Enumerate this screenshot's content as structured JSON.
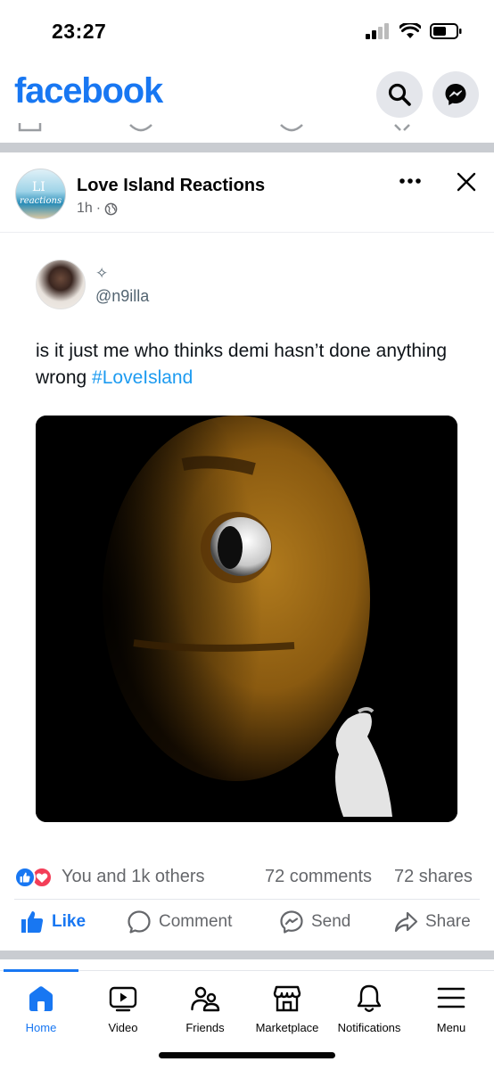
{
  "status_bar": {
    "time": "23:27"
  },
  "header": {
    "logo": "facebook",
    "search_icon": "search-icon",
    "messenger_icon": "messenger-icon"
  },
  "post": {
    "page_name": "Love Island Reactions",
    "time": "1h",
    "separator": "·",
    "audience_icon": "globe-icon",
    "avatar_ll": "LI",
    "avatar_text": "reactions",
    "tweet": {
      "sparkle": "✧",
      "handle": "@n9illa",
      "text": "is it just me who thinks demi hasn’t done anything wrong ",
      "hashtag": "#LoveIsland"
    },
    "reactions_text": "You and 1k others",
    "comments": "72 comments",
    "shares": "72 shares"
  },
  "actions": {
    "like": "Like",
    "comment": "Comment",
    "send": "Send",
    "share": "Share"
  },
  "tabs": [
    {
      "label": "Home",
      "icon": "home-icon"
    },
    {
      "label": "Video",
      "icon": "video-icon"
    },
    {
      "label": "Friends",
      "icon": "friends-icon"
    },
    {
      "label": "Marketplace",
      "icon": "marketplace-icon"
    },
    {
      "label": "Notifications",
      "icon": "bell-icon"
    },
    {
      "label": "Menu",
      "icon": "menu-icon"
    }
  ],
  "colors": {
    "brand": "#1877f2",
    "love": "#f33e58",
    "hashtag": "#1d9bf0",
    "secondary_text": "#65676b"
  }
}
